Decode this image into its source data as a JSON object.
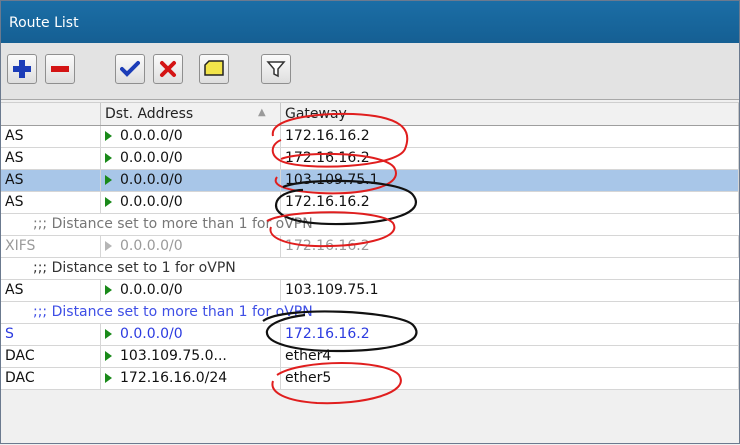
{
  "window": {
    "title": "Route List"
  },
  "toolbar": {
    "buttons": [
      {
        "name": "add",
        "icon": "plus-icon",
        "color": "#1c3db8"
      },
      {
        "name": "remove",
        "icon": "minus-icon",
        "color": "#d41414"
      },
      {
        "name": "enable",
        "icon": "check-icon",
        "color": "#1c3db8"
      },
      {
        "name": "disable",
        "icon": "x-icon",
        "color": "#d41414"
      },
      {
        "name": "comment",
        "icon": "note-icon",
        "color": "#f2e44a"
      },
      {
        "name": "filter",
        "icon": "filter-icon",
        "color": "#333333"
      }
    ]
  },
  "table": {
    "headers": [
      "",
      "Dst. Address",
      "Gateway"
    ],
    "rows": [
      {
        "type": "route",
        "flags": "AS",
        "dst": "0.0.0.0/0",
        "gateway": "172.16.16.2"
      },
      {
        "type": "route",
        "flags": "AS",
        "dst": "0.0.0.0/0",
        "gateway": "172.16.16.2"
      },
      {
        "type": "route",
        "flags": "AS",
        "dst": "0.0.0.0/0",
        "gateway": "103.109.75.1",
        "selected": true
      },
      {
        "type": "route",
        "flags": "AS",
        "dst": "0.0.0.0/0",
        "gateway": "172.16.16.2"
      },
      {
        "type": "comment",
        "text": ";;; Distance set to more than 1 for oVPN"
      },
      {
        "type": "route",
        "flags": "XIFS",
        "dst": "0.0.0.0/0",
        "gateway": "172.16.16.2",
        "inactive": true
      },
      {
        "type": "comment",
        "text": ";;; Distance set to 1 for oVPN"
      },
      {
        "type": "route",
        "flags": "AS",
        "dst": "0.0.0.0/0",
        "gateway": "103.109.75.1"
      },
      {
        "type": "comment",
        "text": ";;; Distance set to more than 1 for oVPN",
        "blue": true
      },
      {
        "type": "route",
        "flags": "S",
        "dst": "0.0.0.0/0",
        "gateway": "172.16.16.2",
        "blue": true
      },
      {
        "type": "route",
        "flags": "DAC",
        "dst": "103.109.75.0...",
        "gateway": "ether4"
      },
      {
        "type": "route",
        "flags": "DAC",
        "dst": "172.16.16.0/24",
        "gateway": "ether5"
      }
    ]
  },
  "colors": {
    "titlebar": "#1b6ea6",
    "selected_row": "#a8c6e8",
    "annotation_red": "#e01e1e",
    "annotation_black": "#111111",
    "blue_text": "#2c3be0"
  }
}
